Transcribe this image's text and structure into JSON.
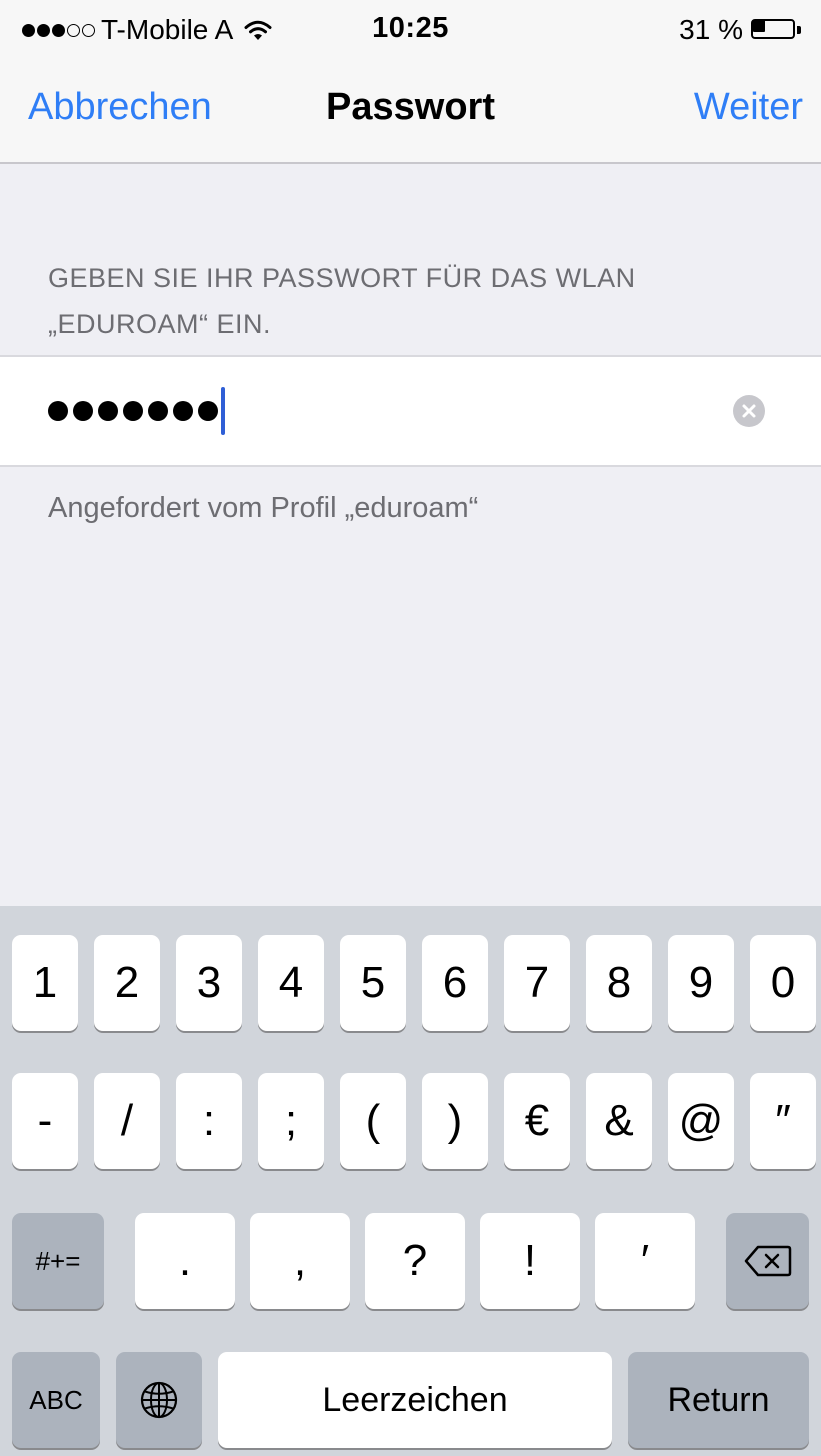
{
  "status_bar": {
    "carrier": "T-Mobile A",
    "time": "10:25",
    "battery_text": "31 %",
    "battery_level": 0.31,
    "signal_bars_filled": 3,
    "signal_bars_total": 5,
    "icons": [
      "signal-icon",
      "wifi-icon",
      "battery-icon"
    ]
  },
  "navbar": {
    "cancel_label": "Abbrechen",
    "title": "Passwort",
    "next_label": "Weiter",
    "accent_color": "#2f7ef6"
  },
  "form": {
    "header_line1": "GEBEN SIE IHR PASSWORT FÜR DAS WLAN",
    "header_line2": "„EDUROAM“ EIN.",
    "password_mask_length": 7,
    "footer": "Angefordert vom Profil „eduroam“"
  },
  "keyboard": {
    "row1": [
      "1",
      "2",
      "3",
      "4",
      "5",
      "6",
      "7",
      "8",
      "9",
      "0"
    ],
    "row2": [
      "-",
      "/",
      ":",
      ";",
      "(",
      ")",
      "€",
      "&",
      "@",
      "″"
    ],
    "row3": {
      "mode_label": "#+=",
      "keys": [
        ".",
        ",",
        "?",
        "!",
        "′"
      ],
      "backspace_icon": "backspace-icon"
    },
    "row4": {
      "abc_label": "ABC",
      "globe_icon": "globe-icon",
      "space_label": "Leerzeichen",
      "return_label": "Return"
    }
  }
}
